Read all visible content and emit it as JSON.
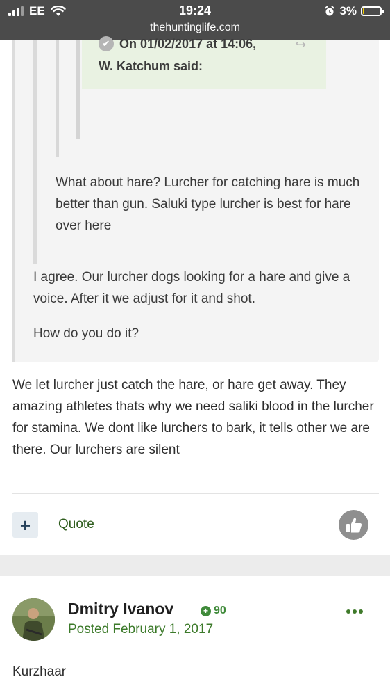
{
  "status_bar": {
    "carrier": "EE",
    "time": "19:24",
    "url": "thehuntinglife.com",
    "battery_text": "3%",
    "battery_level": 0.03
  },
  "nested_quote": {
    "cite_date": "On 01/02/2017 at 14:06,",
    "cite_author": "W. Katchum said:"
  },
  "inner_quote": {
    "text": "What about hare? Lurcher for catching hare is much better than gun. Saluki type lurcher is best for hare over here"
  },
  "outer_quote": {
    "text": "I agree. Our lurcher dogs looking for a hare and give a voice. After it we adjust for it and shot.",
    "question": "How do you do it?"
  },
  "post": {
    "body": "We let lurcher just catch the hare, or hare get away. They amazing athletes thats why we need saliki blood in the lurcher for stamina. We dont like lurchers to bark, it tells other we are there. Our lurchers are silent",
    "plus_label": "+",
    "quote_label": "Quote"
  },
  "next_post": {
    "author": "Dmitry Ivanov",
    "reputation": "90",
    "posted": "Posted February 1, 2017",
    "body": "Kurzhaar"
  },
  "colors": {
    "status_bar_bg": "#4b4b4b",
    "accent_green": "#3f8a3a",
    "quote_bg": "#f4f4f4",
    "cite_bg": "#e9f2e2"
  }
}
